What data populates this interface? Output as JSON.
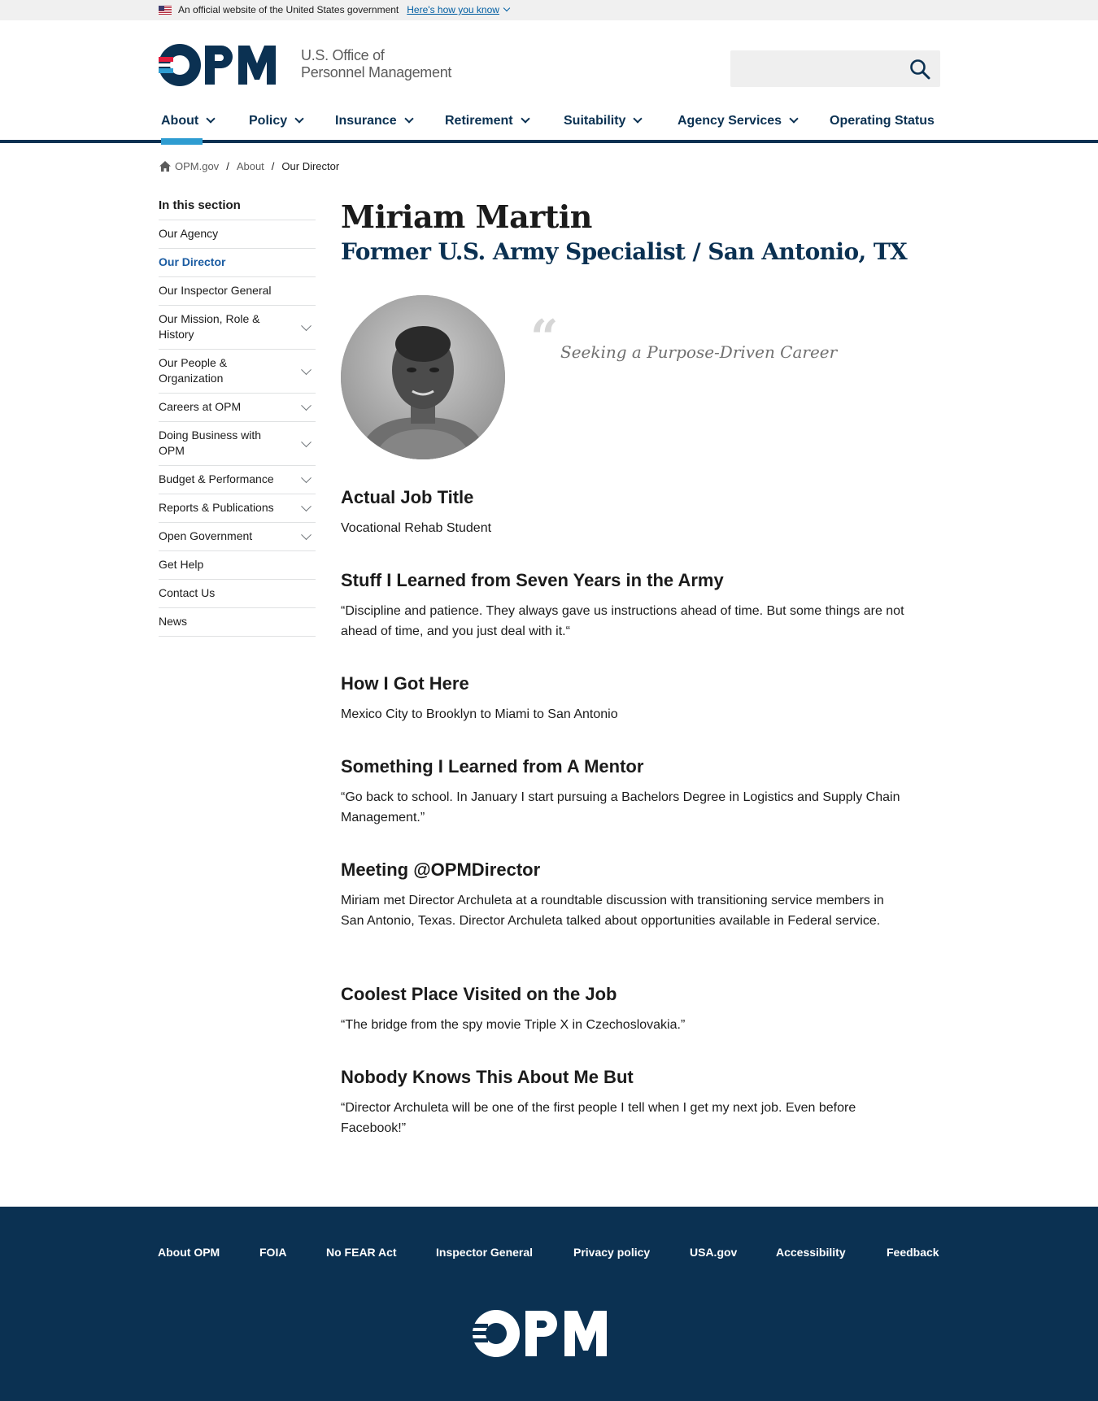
{
  "gov_banner": {
    "text": "An official website of the United States government",
    "link": "Here's how you know"
  },
  "header": {
    "logo_text": "OPM",
    "agency_line1": "U.S. Office of",
    "agency_line2": "Personnel Management",
    "search_placeholder": ""
  },
  "nav": {
    "items": [
      "About",
      "Policy",
      "Insurance",
      "Retirement",
      "Suitability",
      "Agency Services",
      "Operating Status"
    ]
  },
  "breadcrumb": {
    "home": "OPM.gov",
    "parent": "About",
    "current": "Our Director",
    "separator": "/"
  },
  "sidebar": {
    "title": "In this section",
    "items": [
      {
        "label": "Our Agency"
      },
      {
        "label": "Our Director"
      },
      {
        "label": "Our Inspector General"
      },
      {
        "label": "Our Mission, Role & History"
      },
      {
        "label": "Our People & Organization"
      },
      {
        "label": "Careers at OPM"
      },
      {
        "label": "Doing Business with OPM"
      },
      {
        "label": "Budget & Performance"
      },
      {
        "label": "Reports & Publications"
      },
      {
        "label": "Open Government"
      },
      {
        "label": "Get Help"
      },
      {
        "label": "Contact Us"
      },
      {
        "label": "News"
      }
    ]
  },
  "main": {
    "title": "Miriam Martin",
    "subtitle": "Former U.S. Army Specialist / San Antonio, TX",
    "quote_mark": "“",
    "quote": "Seeking a Purpose-Driven Career",
    "sections": [
      {
        "heading": "Actual Job Title",
        "body": "Vocational Rehab Student"
      },
      {
        "heading": "Stuff I Learned from Seven Years in the Army",
        "body": "“Discipline and patience. They always gave us instructions ahead of time. But some things are not ahead of time, and you just deal with it.“"
      },
      {
        "heading": "How I Got Here",
        "body": "Mexico City to Brooklyn to Miami to San Antonio"
      },
      {
        "heading": "Something I Learned from A Mentor",
        "body": "“Go back to school. In January I start pursuing a Bachelors Degree in Logistics and Supply Chain Management.”"
      },
      {
        "heading": "Meeting @OPMDirector",
        "body": "Miriam met Director Archuleta at a roundtable discussion with transitioning service members in San Antonio, Texas. Director Archuleta talked about opportunities available in Federal service."
      },
      {
        "heading": "Coolest Place Visited on the Job",
        "body": "“The bridge from the spy movie Triple X in Czechoslovakia.”"
      },
      {
        "heading": "Nobody Knows This About Me But",
        "body": "“Director Archuleta will be one of the first people I tell when I get my next job. Even before Facebook!”"
      }
    ]
  },
  "footer": {
    "links": [
      "About OPM",
      "FOIA",
      "No FEAR Act",
      "Inspector General",
      "Privacy policy",
      "USA.gov",
      "Accessibility",
      "Feedback"
    ],
    "logo_text": "OPM"
  },
  "colors": {
    "navy": "#0b3152",
    "accent_blue": "#2e9cd1",
    "active_link": "#1a5ba1",
    "logo_red": "#e31c3d"
  }
}
